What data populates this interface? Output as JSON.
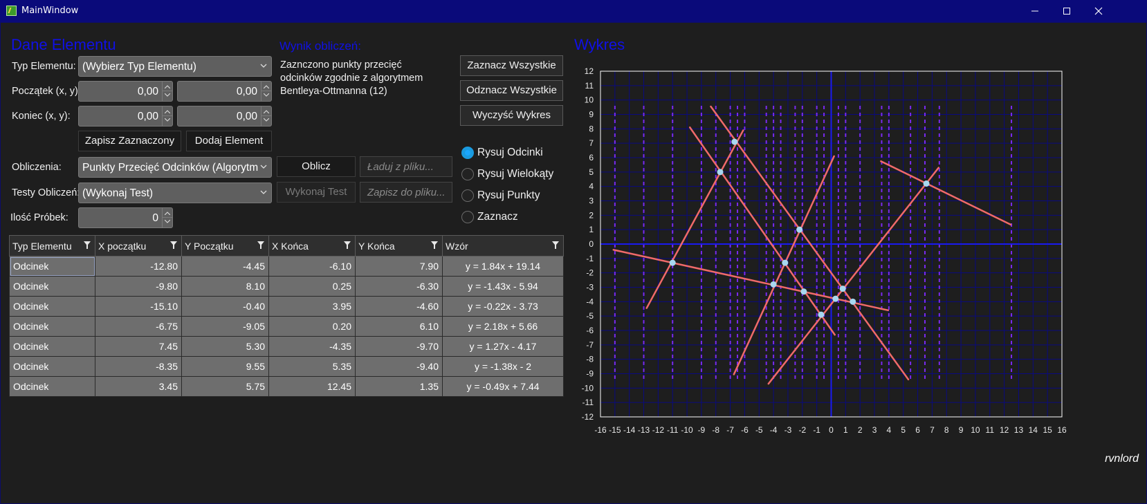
{
  "window": {
    "title": "MainWindow"
  },
  "left": {
    "section_title": "Dane Elementu",
    "type_label": "Typ Elementu:",
    "type_value": "(Wybierz Typ Elementu)",
    "start_label": "Początek (x, y):",
    "start_x": "0,00",
    "start_y": "0,00",
    "end_label": "Koniec (x, y):",
    "end_x": "0,00",
    "end_y": "0,00",
    "save_selected": "Zapisz Zaznaczony",
    "add_element": "Dodaj Element",
    "calc_label": "Obliczenia:",
    "calc_value": "Punkty Przecięć Odcinków (Algorytm",
    "compute": "Oblicz",
    "load_placeholder": "Ładuj z pliku...",
    "tests_label": "Testy Obliczeń:",
    "tests_value": "(Wykonaj Test)",
    "run_test": "Wykonaj Test",
    "save_placeholder": "Zapisz do pliku...",
    "samples_label": "Ilość Próbek:",
    "samples_value": "0"
  },
  "result": {
    "title": "Wynik obliczeń:",
    "text": "Zaznczono punkty przecięć odcinków zgodnie z algorytmem Bentleya-Ottmanna (12)"
  },
  "buttons": {
    "select_all": "Zaznacz Wszystkie",
    "deselect_all": "Odznacz Wszystkie",
    "clear_plot": "Wyczyść Wykres"
  },
  "radios": [
    {
      "label": "Rysuj Odcinki",
      "checked": true
    },
    {
      "label": "Rysuj Wielokąty",
      "checked": false
    },
    {
      "label": "Rysuj Punkty",
      "checked": false
    },
    {
      "label": "Zaznacz",
      "checked": false
    }
  ],
  "table": {
    "columns": [
      "Typ Elementu",
      "X początku",
      "Y Początku",
      "X Końca",
      "Y Końca",
      "Wzór"
    ],
    "rows": [
      [
        "Odcinek",
        "-12.80",
        "-4.45",
        "-6.10",
        "7.90",
        "y = 1.84x + 19.14"
      ],
      [
        "Odcinek",
        "-9.80",
        "8.10",
        "0.25",
        "-6.30",
        "y = -1.43x - 5.94"
      ],
      [
        "Odcinek",
        "-15.10",
        "-0.40",
        "3.95",
        "-4.60",
        "y = -0.22x - 3.73"
      ],
      [
        "Odcinek",
        "-6.75",
        "-9.05",
        "0.20",
        "6.10",
        "y = 2.18x + 5.66"
      ],
      [
        "Odcinek",
        "7.45",
        "5.30",
        "-4.35",
        "-9.70",
        "y = 1.27x - 4.17"
      ],
      [
        "Odcinek",
        "-8.35",
        "9.55",
        "5.35",
        "-9.40",
        "y = -1.38x - 2"
      ],
      [
        "Odcinek",
        "3.45",
        "5.75",
        "12.45",
        "1.35",
        "y = -0.49x + 7.44"
      ]
    ]
  },
  "plot": {
    "title": "Wykres"
  },
  "signature": "rvnlord",
  "colors": {
    "accent_blue": "#1010e6",
    "segment": "#f06a6a",
    "point": "#a8d8f0",
    "grid": "#0a0a80",
    "axis": "#1a1af0",
    "dotted": "#7a2af0"
  },
  "chart_data": {
    "type": "scatter",
    "title": "Wykres",
    "xlim": [
      -16,
      16
    ],
    "ylim": [
      -12,
      12
    ],
    "xticks": [
      -16,
      -15,
      -14,
      -13,
      -12,
      -11,
      -10,
      -9,
      -8,
      -7,
      -6,
      -5,
      -4,
      -3,
      -2,
      -1,
      0,
      1,
      2,
      3,
      4,
      5,
      6,
      7,
      8,
      9,
      10,
      11,
      12,
      13,
      14,
      15,
      16
    ],
    "yticks": [
      12,
      11,
      10,
      9,
      8,
      7,
      6,
      5,
      4,
      3,
      2,
      1,
      0,
      -1,
      -2,
      -3,
      -4,
      -5,
      -6,
      -7,
      -8,
      -9,
      -10,
      -11,
      -12
    ],
    "grid": true,
    "segments": [
      {
        "x1": -12.8,
        "y1": -4.45,
        "x2": -6.1,
        "y2": 7.9
      },
      {
        "x1": -9.8,
        "y1": 8.1,
        "x2": 0.25,
        "y2": -6.3
      },
      {
        "x1": -15.1,
        "y1": -0.4,
        "x2": 3.95,
        "y2": -4.6
      },
      {
        "x1": -6.75,
        "y1": -9.05,
        "x2": 0.2,
        "y2": 6.1
      },
      {
        "x1": 7.45,
        "y1": 5.3,
        "x2": -4.35,
        "y2": -9.7
      },
      {
        "x1": -8.35,
        "y1": 9.55,
        "x2": 5.35,
        "y2": -9.4
      },
      {
        "x1": 3.45,
        "y1": 5.75,
        "x2": 12.45,
        "y2": 1.35
      }
    ],
    "intersections": [
      [
        -6.7,
        7.1
      ],
      [
        -7.7,
        5.0
      ],
      [
        -11.0,
        -1.3
      ],
      [
        -2.2,
        1.0
      ],
      [
        -3.2,
        -1.3
      ],
      [
        -4.0,
        -2.8
      ],
      [
        -1.9,
        -3.3
      ],
      [
        0.8,
        -3.1
      ],
      [
        0.3,
        -3.8
      ],
      [
        1.5,
        -4.0
      ],
      [
        -0.7,
        -4.9
      ],
      [
        6.6,
        4.2
      ]
    ],
    "dotted_x": [
      -15,
      -13,
      -11,
      -9,
      -8,
      -7,
      -6.5,
      -6,
      -4.5,
      -4,
      -3.5,
      -2.5,
      -2,
      -1,
      -0.5,
      0.5,
      1,
      2,
      3.5,
      4,
      5.5,
      6.5,
      7.5,
      12.5
    ]
  }
}
